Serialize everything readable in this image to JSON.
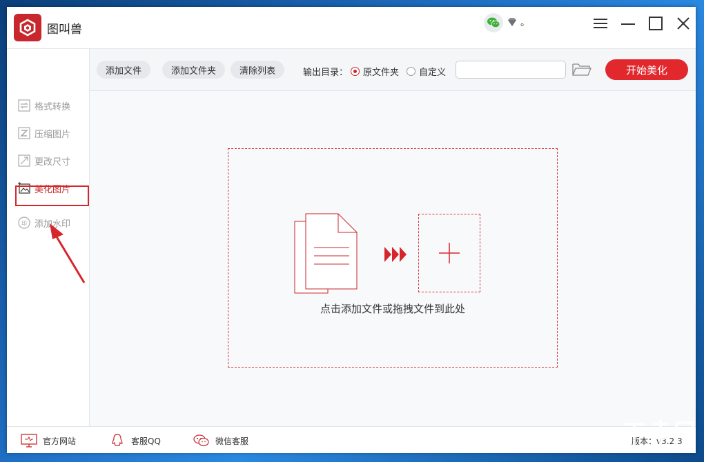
{
  "app": {
    "title": "图叫兽",
    "user_suffix": "。",
    "version": "版本：v3.2.3"
  },
  "sidebar": {
    "items": [
      {
        "label": "格式转换",
        "icon": "convert-icon"
      },
      {
        "label": "压缩图片",
        "icon": "compress-icon"
      },
      {
        "label": "更改尺寸",
        "icon": "resize-icon"
      },
      {
        "label": "美化图片",
        "icon": "beautify-icon",
        "active": true
      },
      {
        "label": "添加水印",
        "icon": "watermark-icon"
      }
    ]
  },
  "toolbar": {
    "add_file": "添加文件",
    "add_folder": "添加文件夹",
    "clear_list": "清除列表",
    "output_label": "输出目录：",
    "radio_original": "原文件夹",
    "radio_custom": "自定义",
    "path_value": "",
    "start": "开始美化"
  },
  "main": {
    "drop_hint": "点击添加文件或拖拽文件到此处"
  },
  "footer": {
    "website": "官方网站",
    "qq": "客服QQ",
    "wechat": "微信客服"
  },
  "colors": {
    "accent": "#e1282d",
    "sidebar_inactive": "#9a9a9a"
  }
}
